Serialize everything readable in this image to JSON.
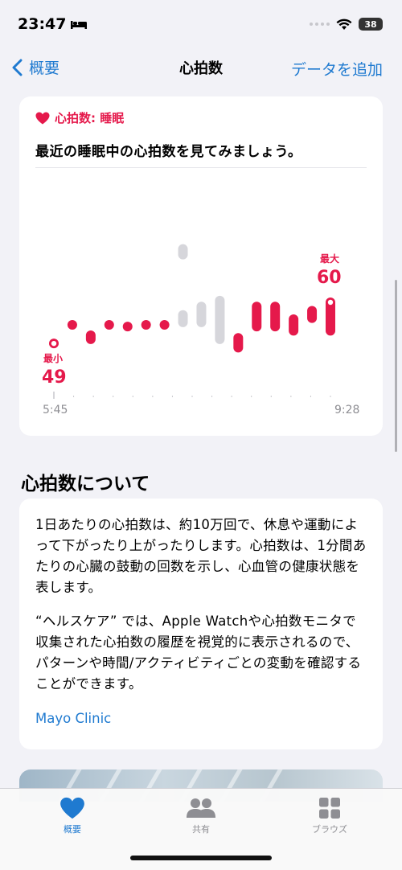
{
  "status_bar": {
    "time": "23:47",
    "battery": "38"
  },
  "nav": {
    "back_label": "概要",
    "title": "心拍数",
    "action_label": "データを追加"
  },
  "chart_card": {
    "header": "心拍数: 睡眠",
    "headline": "最近の睡眠中の心拍数を見てみましょう。",
    "min_label": "最小",
    "min_value": "49",
    "max_label": "最大",
    "max_value": "60",
    "x_start": "5:45",
    "x_end": "9:28",
    "colors": {
      "accent": "#e5194b",
      "muted": "#d6d6db"
    }
  },
  "chart_data": {
    "type": "range",
    "x_start": "5:45",
    "x_end": "9:28",
    "ylim": [
      47,
      66
    ],
    "min": 49,
    "max": 60,
    "bars": [
      {
        "low": 50.5,
        "high": 51.2,
        "highlight": "min"
      },
      {
        "low": 52.7,
        "high": 53.0
      },
      {
        "low": 51.0,
        "high": 52.6
      },
      {
        "low": 52.7,
        "high": 53.0
      },
      {
        "low": 52.5,
        "high": 53.5
      },
      {
        "low": 52.7,
        "high": 53.0
      },
      {
        "low": 52.7,
        "high": 53.0
      },
      {
        "low": 53.0,
        "high": 55.0,
        "muted": true
      },
      {
        "low": 53.0,
        "high": 56.0,
        "muted": true
      },
      {
        "low": 51.0,
        "high": 56.7,
        "muted": true
      },
      {
        "low": 50.0,
        "high": 52.3
      },
      {
        "low": 52.5,
        "high": 56.0
      },
      {
        "low": 52.5,
        "high": 56.0
      },
      {
        "low": 52.0,
        "high": 54.5
      },
      {
        "low": 53.5,
        "high": 55.5
      },
      {
        "low": 52.0,
        "high": 56.5,
        "highlight": "max"
      }
    ],
    "floating_bar": {
      "index": 7,
      "low": 61.0,
      "high": 62.8
    }
  },
  "about": {
    "section_title": "心拍数について",
    "paragraph1": "1日あたりの心拍数は、約10万回で、休息や運動によって下がったり上がったりします。心拍数は、1分間あたりの心臓の鼓動の回数を示し、心血管の健康状態を表します。",
    "paragraph2": "“ヘルスケア” では、Apple Watchや心拍数モニタで収集された心拍数の履歴を視覚的に表示されるので、パターンや時間/アクティビティごとの変動を確認することができます。",
    "link_label": "Mayo Clinic"
  },
  "tabs": [
    {
      "label": "概要",
      "icon": "heart-icon",
      "active": true
    },
    {
      "label": "共有",
      "icon": "people-icon",
      "active": false
    },
    {
      "label": "ブラウズ",
      "icon": "grid-icon",
      "active": false
    }
  ]
}
